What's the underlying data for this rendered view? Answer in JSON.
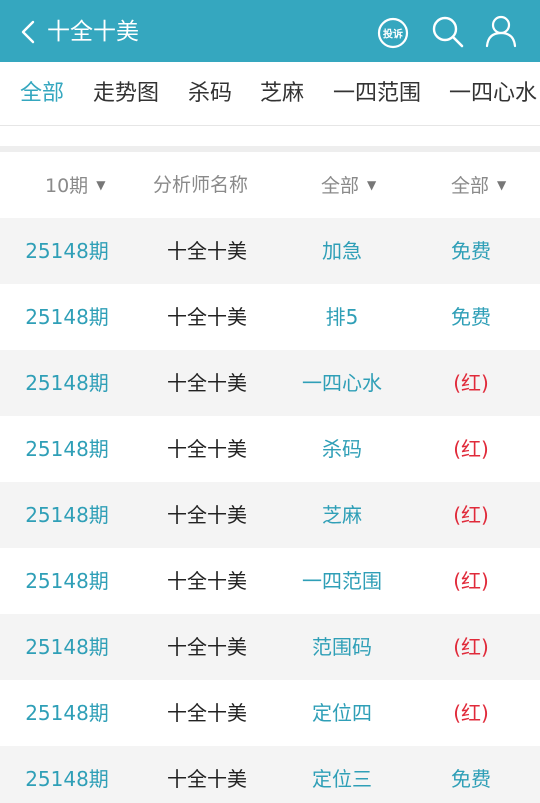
{
  "header": {
    "title": "十全十美",
    "complain_label": "投诉",
    "background": "#35a7bf"
  },
  "tabs": [
    {
      "label": "全部",
      "active": true
    },
    {
      "label": "走势图",
      "active": false
    },
    {
      "label": "杀码",
      "active": false
    },
    {
      "label": "芝麻",
      "active": false
    },
    {
      "label": "一四范围",
      "active": false
    },
    {
      "label": "一四心水",
      "active": false
    }
  ],
  "filters": {
    "period": "10期",
    "analyst_header": "分析师名称",
    "type": "全部",
    "status": "全部"
  },
  "rows": [
    {
      "issue": "25148期",
      "analyst": "十全十美",
      "type": "加急",
      "status": "免费",
      "status_kind": "free"
    },
    {
      "issue": "25148期",
      "analyst": "十全十美",
      "type": "排5",
      "status": "免费",
      "status_kind": "free"
    },
    {
      "issue": "25148期",
      "analyst": "十全十美",
      "type": "一四心水",
      "status": "(红)",
      "status_kind": "red"
    },
    {
      "issue": "25148期",
      "analyst": "十全十美",
      "type": "杀码",
      "status": "(红)",
      "status_kind": "red"
    },
    {
      "issue": "25148期",
      "analyst": "十全十美",
      "type": "芝麻",
      "status": "(红)",
      "status_kind": "red"
    },
    {
      "issue": "25148期",
      "analyst": "十全十美",
      "type": "一四范围",
      "status": "(红)",
      "status_kind": "red"
    },
    {
      "issue": "25148期",
      "analyst": "十全十美",
      "type": "范围码",
      "status": "(红)",
      "status_kind": "red"
    },
    {
      "issue": "25148期",
      "analyst": "十全十美",
      "type": "定位四",
      "status": "(红)",
      "status_kind": "red"
    },
    {
      "issue": "25148期",
      "analyst": "十全十美",
      "type": "定位三",
      "status": "免费",
      "status_kind": "free"
    }
  ],
  "colors": {
    "accent": "#35a7bf",
    "link": "#2f9fb7",
    "red_status": "#e02a3a"
  }
}
